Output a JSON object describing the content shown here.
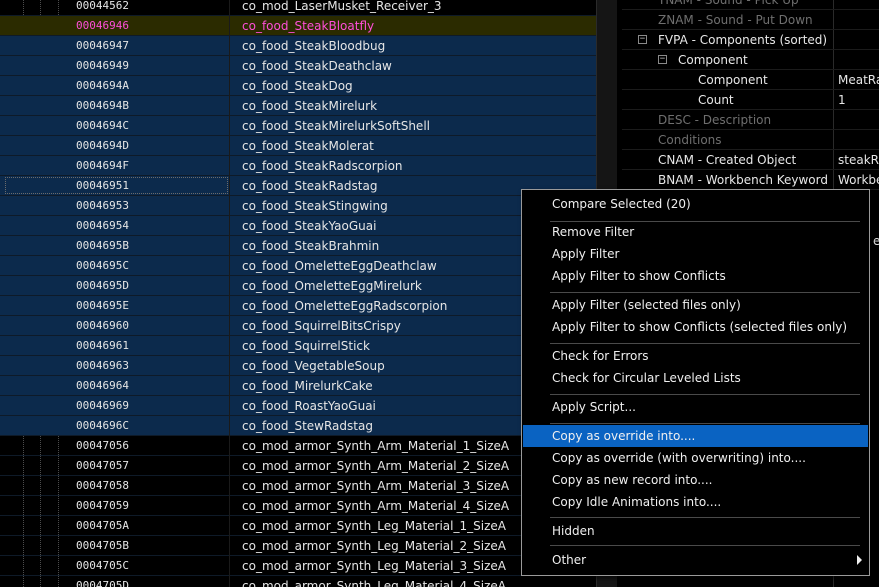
{
  "records": [
    {
      "formid": "00044562",
      "editor_id": "co_mod_LaserMusket_Receiver_3",
      "state": "normal"
    },
    {
      "formid": "00046946",
      "editor_id": "co_food_SteakBloatfly",
      "state": "highlight"
    },
    {
      "formid": "00046947",
      "editor_id": "co_food_SteakBloodbug",
      "state": "selected"
    },
    {
      "formid": "00046949",
      "editor_id": "co_food_SteakDeathclaw",
      "state": "selected"
    },
    {
      "formid": "0004694A",
      "editor_id": "co_food_SteakDog",
      "state": "selected"
    },
    {
      "formid": "0004694B",
      "editor_id": "co_food_SteakMirelurk",
      "state": "selected"
    },
    {
      "formid": "0004694C",
      "editor_id": "co_food_SteakMirelurkSoftShell",
      "state": "selected"
    },
    {
      "formid": "0004694D",
      "editor_id": "co_food_SteakMolerat",
      "state": "selected"
    },
    {
      "formid": "0004694F",
      "editor_id": "co_food_SteakRadscorpion",
      "state": "selected"
    },
    {
      "formid": "00046951",
      "editor_id": "co_food_SteakRadstag",
      "state": "focused"
    },
    {
      "formid": "00046953",
      "editor_id": "co_food_SteakStingwing",
      "state": "selected"
    },
    {
      "formid": "00046954",
      "editor_id": "co_food_SteakYaoGuai",
      "state": "selected"
    },
    {
      "formid": "0004695B",
      "editor_id": "co_food_SteakBrahmin",
      "state": "selected"
    },
    {
      "formid": "0004695C",
      "editor_id": "co_food_OmeletteEggDeathclaw",
      "state": "selected"
    },
    {
      "formid": "0004695D",
      "editor_id": "co_food_OmeletteEggMirelurk",
      "state": "selected"
    },
    {
      "formid": "0004695E",
      "editor_id": "co_food_OmeletteEggRadscorpion",
      "state": "selected"
    },
    {
      "formid": "00046960",
      "editor_id": "co_food_SquirrelBitsCrispy",
      "state": "selected"
    },
    {
      "formid": "00046961",
      "editor_id": "co_food_SquirrelStick",
      "state": "selected"
    },
    {
      "formid": "00046963",
      "editor_id": "co_food_VegetableSoup",
      "state": "selected"
    },
    {
      "formid": "00046964",
      "editor_id": "co_food_MirelurkCake",
      "state": "selected"
    },
    {
      "formid": "00046969",
      "editor_id": "co_food_RoastYaoGuai",
      "state": "selected"
    },
    {
      "formid": "0004696C",
      "editor_id": "co_food_StewRadstag",
      "state": "selected"
    },
    {
      "formid": "00047056",
      "editor_id": "co_mod_armor_Synth_Arm_Material_1_SizeA",
      "state": "normal"
    },
    {
      "formid": "00047057",
      "editor_id": "co_mod_armor_Synth_Arm_Material_2_SizeA",
      "state": "normal"
    },
    {
      "formid": "00047058",
      "editor_id": "co_mod_armor_Synth_Arm_Material_3_SizeA",
      "state": "normal"
    },
    {
      "formid": "00047059",
      "editor_id": "co_mod_armor_Synth_Arm_Material_4_SizeA",
      "state": "normal"
    },
    {
      "formid": "0004705A",
      "editor_id": "co_mod_armor_Synth_Leg_Material_1_SizeA",
      "state": "normal"
    },
    {
      "formid": "0004705B",
      "editor_id": "co_mod_armor_Synth_Leg_Material_2_SizeA",
      "state": "normal"
    },
    {
      "formid": "0004705C",
      "editor_id": "co_mod_armor_Synth_Leg_Material_3_SizeA",
      "state": "normal"
    },
    {
      "formid": "0004705D",
      "editor_id": "co_mod_armor_Synth_Leg_Material_4_SizeA",
      "state": "normal"
    }
  ],
  "details": [
    {
      "label": "YNAM - Sound - Pick Up",
      "value": "",
      "dim": true
    },
    {
      "label": "ZNAM - Sound - Put Down",
      "value": "",
      "dim": true
    },
    {
      "label": "FVPA - Components (sorted)",
      "value": "",
      "dim": false,
      "expander": "−"
    },
    {
      "label": "Component",
      "value": "",
      "dim": false,
      "expander": "−"
    },
    {
      "label": "Component",
      "value": "MeatRa",
      "dim": false
    },
    {
      "label": "Count",
      "value": "1",
      "dim": false
    },
    {
      "label": "DESC - Description",
      "value": "",
      "dim": true
    },
    {
      "label": "Conditions",
      "value": "",
      "dim": true
    },
    {
      "label": "CNAM - Created Object",
      "value": "steakRa",
      "dim": false
    },
    {
      "label": "BNAM - Workbench Keyword",
      "value": "Workbe",
      "dim": false
    }
  ],
  "context_menu": {
    "items": [
      {
        "label": "Compare Selected (20)"
      },
      {
        "label": "Remove Filter"
      },
      {
        "label": "Apply Filter"
      },
      {
        "label": "Apply Filter to show Conflicts"
      },
      {
        "label": "Apply Filter (selected files only)"
      },
      {
        "label": "Apply Filter to show Conflicts (selected files only)"
      },
      {
        "label": "Check for Errors"
      },
      {
        "label": "Check for Circular Leveled Lists"
      },
      {
        "label": "Apply Script..."
      },
      {
        "label": "Copy as override into...."
      },
      {
        "label": "Copy as override (with overwriting) into...."
      },
      {
        "label": "Copy as new record into...."
      },
      {
        "label": "Copy Idle Animations into...."
      },
      {
        "label": "Hidden"
      },
      {
        "label": "Other"
      }
    ],
    "active_label": "Copy as override into....",
    "partial_right_text": "e"
  },
  "colors": {
    "selection": "#0c2a4c",
    "highlight_row": "#2b2b00",
    "highlight_text": "#ff4fd8",
    "menu_active": "#0a63c2"
  }
}
